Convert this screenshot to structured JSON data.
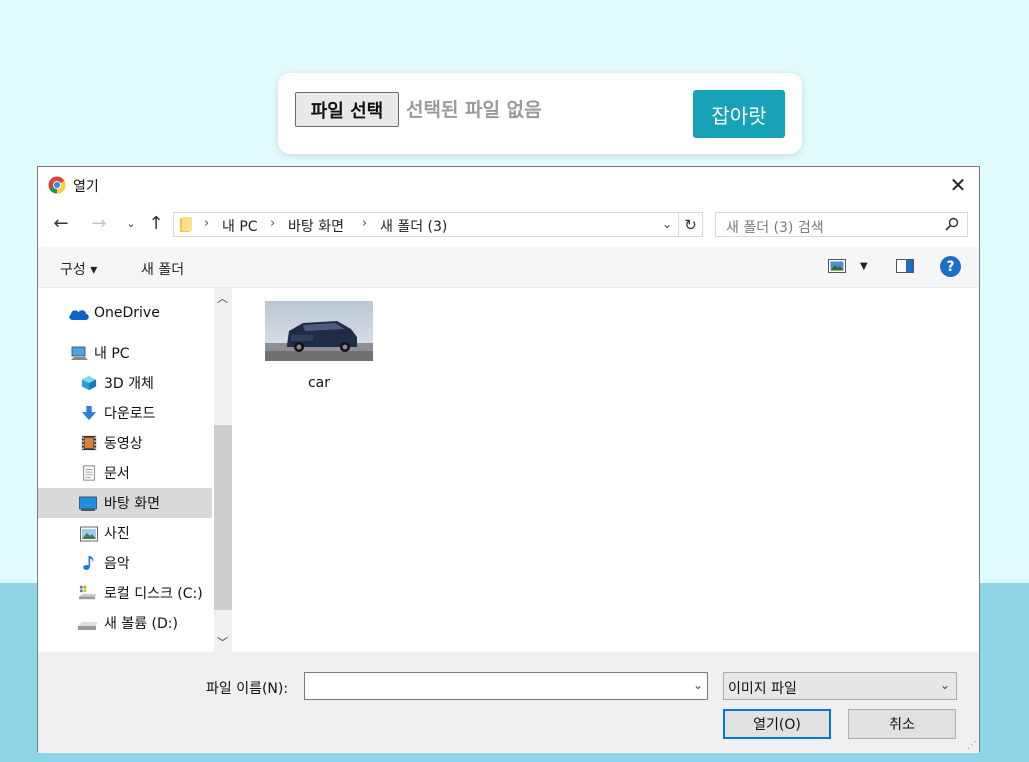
{
  "upload": {
    "choose_file": "파일 선택",
    "status": "선택된 파일 없음",
    "submit": "잡아랏"
  },
  "dialog": {
    "title": "열기",
    "close": "✕",
    "address": {
      "crumbs": [
        "내 PC",
        "바탕 화면",
        "새 폴더 (3)"
      ]
    },
    "search_placeholder": "새 폴더 (3) 검색",
    "toolbar": {
      "organize": "구성 ▾",
      "new_folder": "새 폴더",
      "help": "?"
    },
    "nav_items": [
      {
        "label": "OneDrive",
        "icon": "cloud-icon"
      },
      {
        "label": "내 PC",
        "icon": "computer-icon"
      },
      {
        "label": "3D 개체",
        "icon": "cube-icon"
      },
      {
        "label": "다운로드",
        "icon": "download-icon"
      },
      {
        "label": "동영상",
        "icon": "video-icon"
      },
      {
        "label": "문서",
        "icon": "document-icon"
      },
      {
        "label": "바탕 화면",
        "icon": "desktop-icon",
        "selected": true
      },
      {
        "label": "사진",
        "icon": "picture-icon"
      },
      {
        "label": "음악",
        "icon": "music-icon"
      },
      {
        "label": "로컬 디스크 (C:)",
        "icon": "drive-icon"
      },
      {
        "label": "새 볼륨 (D:)",
        "icon": "drive-icon"
      }
    ],
    "files": [
      {
        "name": "car",
        "type": "image"
      }
    ],
    "footer": {
      "filename_label": "파일 이름(N):",
      "filename_value": "",
      "filetype": "이미지 파일",
      "open": "열기(O)",
      "cancel": "취소"
    }
  },
  "colors": {
    "page_bg": "#e1fcfd",
    "page_bg_bottom": "#8dd5e6",
    "accent": "#17a2b8",
    "selection": "#d9d9d9",
    "help_blue": "#1a6fc7"
  }
}
